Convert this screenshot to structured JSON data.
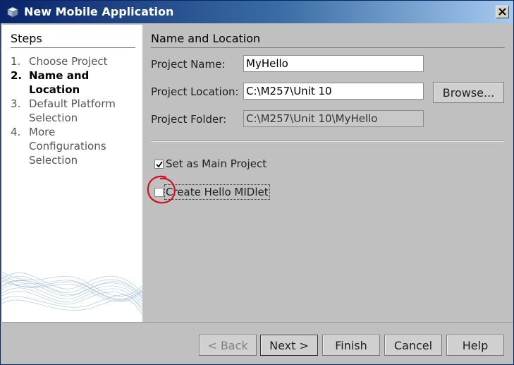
{
  "window": {
    "title": "New Mobile Application",
    "icon": "cube-icon"
  },
  "steps": {
    "heading": "Steps",
    "items": [
      {
        "num": "1.",
        "label": "Choose Project",
        "current": false
      },
      {
        "num": "2.",
        "label": "Name and Location",
        "current": true
      },
      {
        "num": "3.",
        "label": "Default Platform Selection",
        "current": false
      },
      {
        "num": "4.",
        "label": "More Configurations Selection",
        "current": false
      }
    ]
  },
  "main": {
    "heading": "Name and Location",
    "project_name": {
      "label": "Project Name:",
      "value": "MyHello"
    },
    "project_location": {
      "label": "Project Location:",
      "value": "C:\\M257\\Unit 10"
    },
    "browse_label": "Browse...",
    "project_folder": {
      "label": "Project Folder:",
      "value": "C:\\M257\\Unit 10\\MyHello"
    },
    "set_main": {
      "label": "Set as Main Project",
      "checked": true
    },
    "create_midlet": {
      "label": "Create Hello MIDlet",
      "checked": false
    }
  },
  "buttons": {
    "back": "< Back",
    "next": "Next >",
    "finish": "Finish",
    "cancel": "Cancel",
    "help": "Help"
  },
  "colors": {
    "annotation_circle": "#d01020",
    "title_bar": "#0a246a"
  }
}
